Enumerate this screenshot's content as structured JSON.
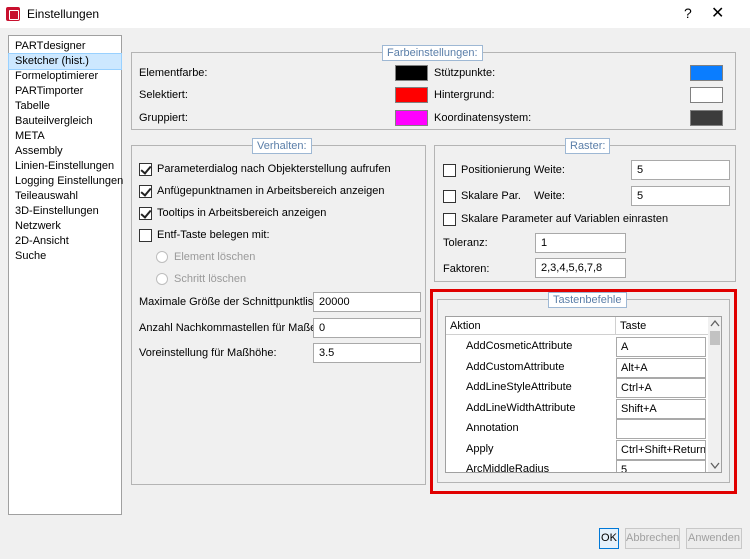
{
  "window": {
    "title": "Einstellungen",
    "help": "?",
    "close": "✕"
  },
  "nav": {
    "items": [
      "PARTdesigner",
      "Sketcher (hist.)",
      "Formeloptimierer",
      "PARTimporter",
      "Tabelle",
      "Bauteilvergleich",
      "META",
      "Assembly",
      "Linien-Einstellungen",
      "Logging Einstellungen",
      "Teileauswahl",
      "3D-Einstellungen",
      "Netzwerk",
      "2D-Ansicht",
      "Suche"
    ],
    "selected_index": 1
  },
  "farbe": {
    "title": "Farbeinstellungen:",
    "labels": [
      "Elementfarbe:",
      "Selektiert:",
      "Gruppiert:",
      "Stützpunkte:",
      "Hintergrund:",
      "Koordinatensystem:"
    ],
    "colors": [
      "#000000",
      "#ff0000",
      "#ff00ff",
      "#0a7dff",
      "#ffffff",
      "#3c3c3c"
    ]
  },
  "verhalten": {
    "title": "Verhalten:",
    "checkboxes": [
      {
        "label": "Parameterdialog nach Objekterstellung aufrufen",
        "checked": true
      },
      {
        "label": "Anfügepunktnamen in Arbeitsbereich anzeigen",
        "checked": true
      },
      {
        "label": "Tooltips in Arbeitsbereich anzeigen",
        "checked": true
      },
      {
        "label": "Entf-Taste belegen mit:",
        "checked": false
      }
    ],
    "radios": [
      "Element löschen",
      "Schritt löschen"
    ],
    "fields": [
      {
        "label": "Maximale Größe der Schnittpunktliste:",
        "value": "20000"
      },
      {
        "label": "Anzahl Nachkommastellen für Maße:",
        "value": "0"
      },
      {
        "label": "Voreinstellung für Maßhöhe:",
        "value": "3.5"
      }
    ]
  },
  "raster": {
    "title": "Raster:",
    "positionierung": "Positionierung",
    "skalare_par": "Skalare Par.",
    "weite_label": "Weite:",
    "weite1": "5",
    "weite2": "5",
    "skalare_einrasten": "Skalare Parameter auf Variablen einrasten",
    "toleranz_label": "Toleranz:",
    "toleranz": "1",
    "faktoren_label": "Faktoren:",
    "faktoren": "2,3,4,5,6,7,8"
  },
  "tasten": {
    "title": "Tastenbefehle",
    "col_aktion": "Aktion",
    "col_taste": "Taste",
    "rows": [
      {
        "aktion": "AddCosmeticAttribute",
        "taste": "A"
      },
      {
        "aktion": "AddCustomAttribute",
        "taste": "Alt+A"
      },
      {
        "aktion": "AddLineStyleAttribute",
        "taste": "Ctrl+A"
      },
      {
        "aktion": "AddLineWidthAttribute",
        "taste": "Shift+A"
      },
      {
        "aktion": "Annotation",
        "taste": ""
      },
      {
        "aktion": "Apply",
        "taste": "Ctrl+Shift+Return"
      },
      {
        "aktion": "ArcMiddleRadius",
        "taste": "5"
      }
    ]
  },
  "buttons": {
    "ok": "OK",
    "abbrechen": "Abbrechen",
    "anwenden": "Anwenden"
  }
}
